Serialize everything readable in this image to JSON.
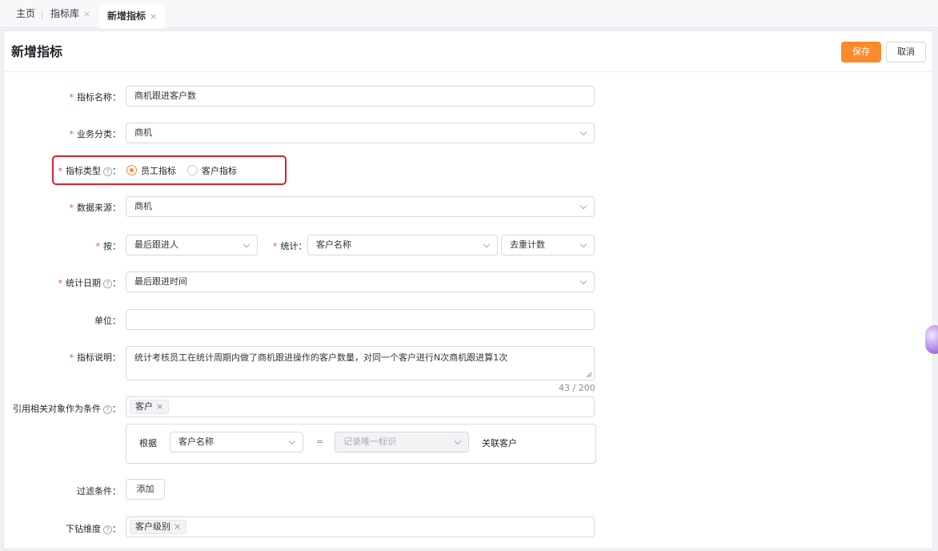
{
  "tabs": [
    {
      "label": "主页",
      "closable": false
    },
    {
      "label": "指标库",
      "closable": true
    },
    {
      "label": "新增指标",
      "closable": true,
      "active": true
    }
  ],
  "tab_close_glyph": "×",
  "page": {
    "title": "新增指标",
    "save_label": "保存",
    "cancel_label": "取消"
  },
  "form": {
    "name": {
      "label": "指标名称：",
      "value": "商机跟进客户数"
    },
    "category": {
      "label": "业务分类：",
      "value": "商机"
    },
    "type": {
      "label": "指标类型",
      "suffix": "：",
      "options": [
        "员工指标",
        "客户指标"
      ],
      "selected": "员工指标"
    },
    "source": {
      "label": "数据来源：",
      "value": "商机"
    },
    "by": {
      "label": "按：",
      "value": "最后跟进人"
    },
    "stat": {
      "label": "统计：",
      "field": "客户名称",
      "method": "去重计数"
    },
    "stat_date": {
      "label": "统计日期",
      "suffix": "：",
      "value": "最后跟进时间"
    },
    "unit": {
      "label": "单位：",
      "value": ""
    },
    "description": {
      "label": "指标说明：",
      "value": "统计考核员工在统计周期内做了商机跟进操作的客户数量，对同一个客户进行N次商机跟进算1次",
      "counter": "43 / 200"
    },
    "ref_condition": {
      "label": "引用相关对象作为条件",
      "suffix": "：",
      "tags": [
        "客户"
      ]
    },
    "relation": {
      "prefix": "根据",
      "left_field": "客户名称",
      "operator": "=",
      "right_placeholder": "记录唯一标识",
      "suffix": "关联客户"
    },
    "filter": {
      "label": "过滤条件：",
      "add_label": "添加"
    },
    "drill": {
      "label": "下钻维度",
      "suffix": "：",
      "tags": [
        "客户级别"
      ]
    }
  },
  "required_mark": "*",
  "help_glyph": "?",
  "tag_close_glyph": "×",
  "colors": {
    "accent": "#fb8a2b",
    "required": "#f04c3e",
    "highlight": "#d9222a"
  }
}
